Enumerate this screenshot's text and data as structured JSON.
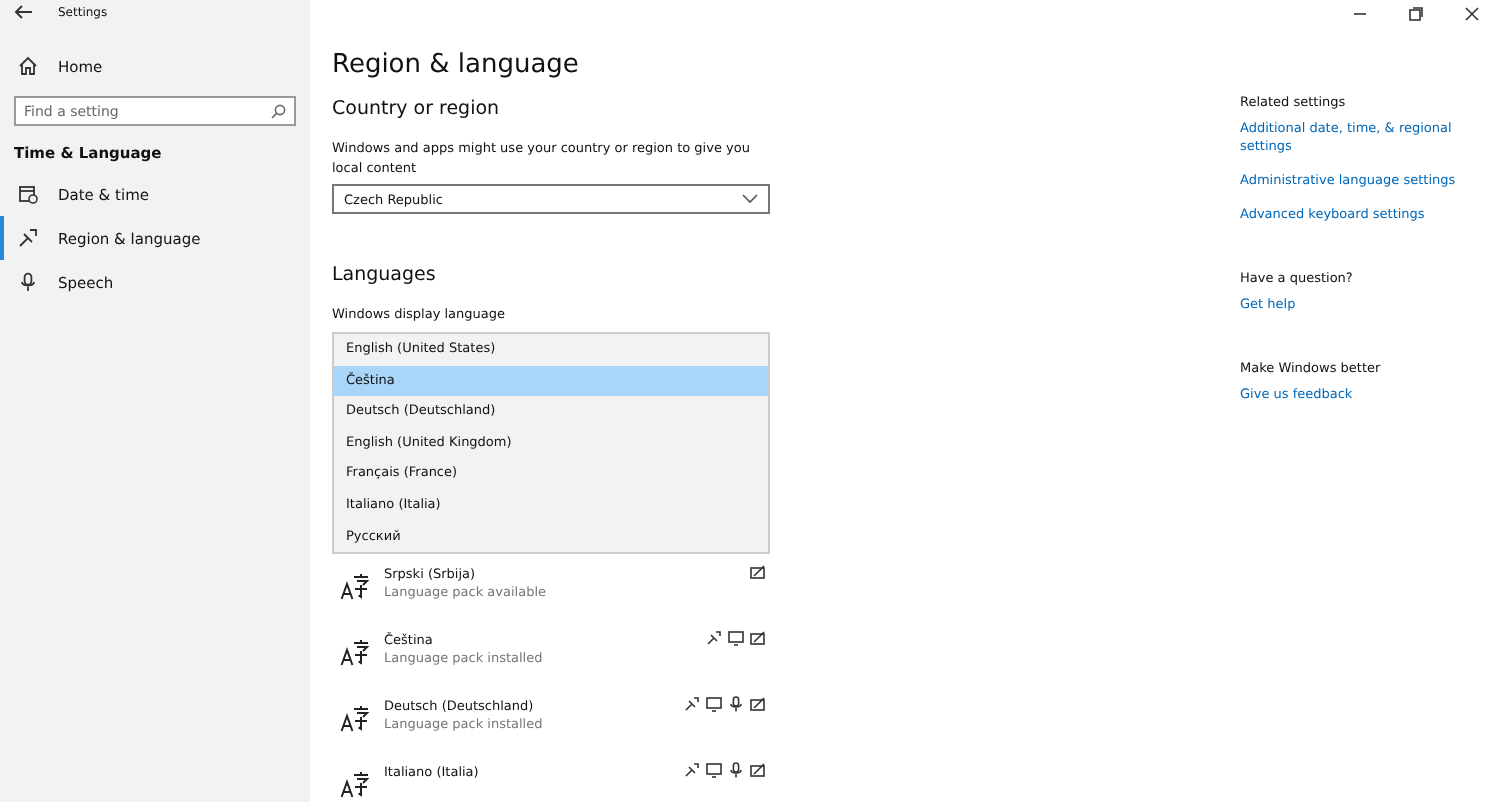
{
  "window": {
    "title": "Settings"
  },
  "sidebar": {
    "home": "Home",
    "search": {
      "placeholder": "Find a setting"
    },
    "section": "Time & Language",
    "items": [
      {
        "label": "Date & time",
        "kind": "calendar",
        "selected": false
      },
      {
        "label": "Region & language",
        "kind": "region",
        "selected": true
      },
      {
        "label": "Speech",
        "kind": "mic",
        "selected": false
      }
    ]
  },
  "page_title": "Region & language",
  "country": {
    "heading": "Country or region",
    "description": "Windows and apps might use your country or region to give you local content",
    "value": "Czech Republic"
  },
  "languages": {
    "heading": "Languages",
    "display_label": "Windows display language",
    "dropdown_options": [
      {
        "label": "English (United States)",
        "selected": false
      },
      {
        "label": "Čeština",
        "selected": true
      },
      {
        "label": "Deutsch (Deutschland)",
        "selected": false
      },
      {
        "label": "English (United Kingdom)",
        "selected": false
      },
      {
        "label": "Français (France)",
        "selected": false
      },
      {
        "label": "Italiano (Italia)",
        "selected": false
      },
      {
        "label": "Русский",
        "selected": false
      }
    ],
    "list": [
      {
        "name": "Srpski (Srbija)",
        "status": "Language pack available",
        "features": [
          {
            "kind": "keyboard"
          }
        ]
      },
      {
        "name": "Čeština",
        "status": "Language pack installed",
        "features": [
          {
            "kind": "display_lang"
          },
          {
            "kind": "display"
          },
          {
            "kind": "keyboard"
          }
        ]
      },
      {
        "name": "Deutsch (Deutschland)",
        "status": "Language pack installed",
        "features": [
          {
            "kind": "display_lang"
          },
          {
            "kind": "display"
          },
          {
            "kind": "speech"
          },
          {
            "kind": "keyboard"
          }
        ]
      },
      {
        "name": "Italiano (Italia)",
        "features": [
          {
            "kind": "display_lang"
          },
          {
            "kind": "display"
          },
          {
            "kind": "speech"
          },
          {
            "kind": "keyboard"
          }
        ]
      }
    ]
  },
  "related": {
    "heading": "Related settings",
    "links": [
      "Additional date, time, & regional settings",
      "Administrative language settings",
      "Advanced keyboard settings"
    ]
  },
  "help": {
    "heading": "Have a question?",
    "link": "Get help"
  },
  "feedback": {
    "heading": "Make Windows better",
    "link": "Give us feedback"
  }
}
